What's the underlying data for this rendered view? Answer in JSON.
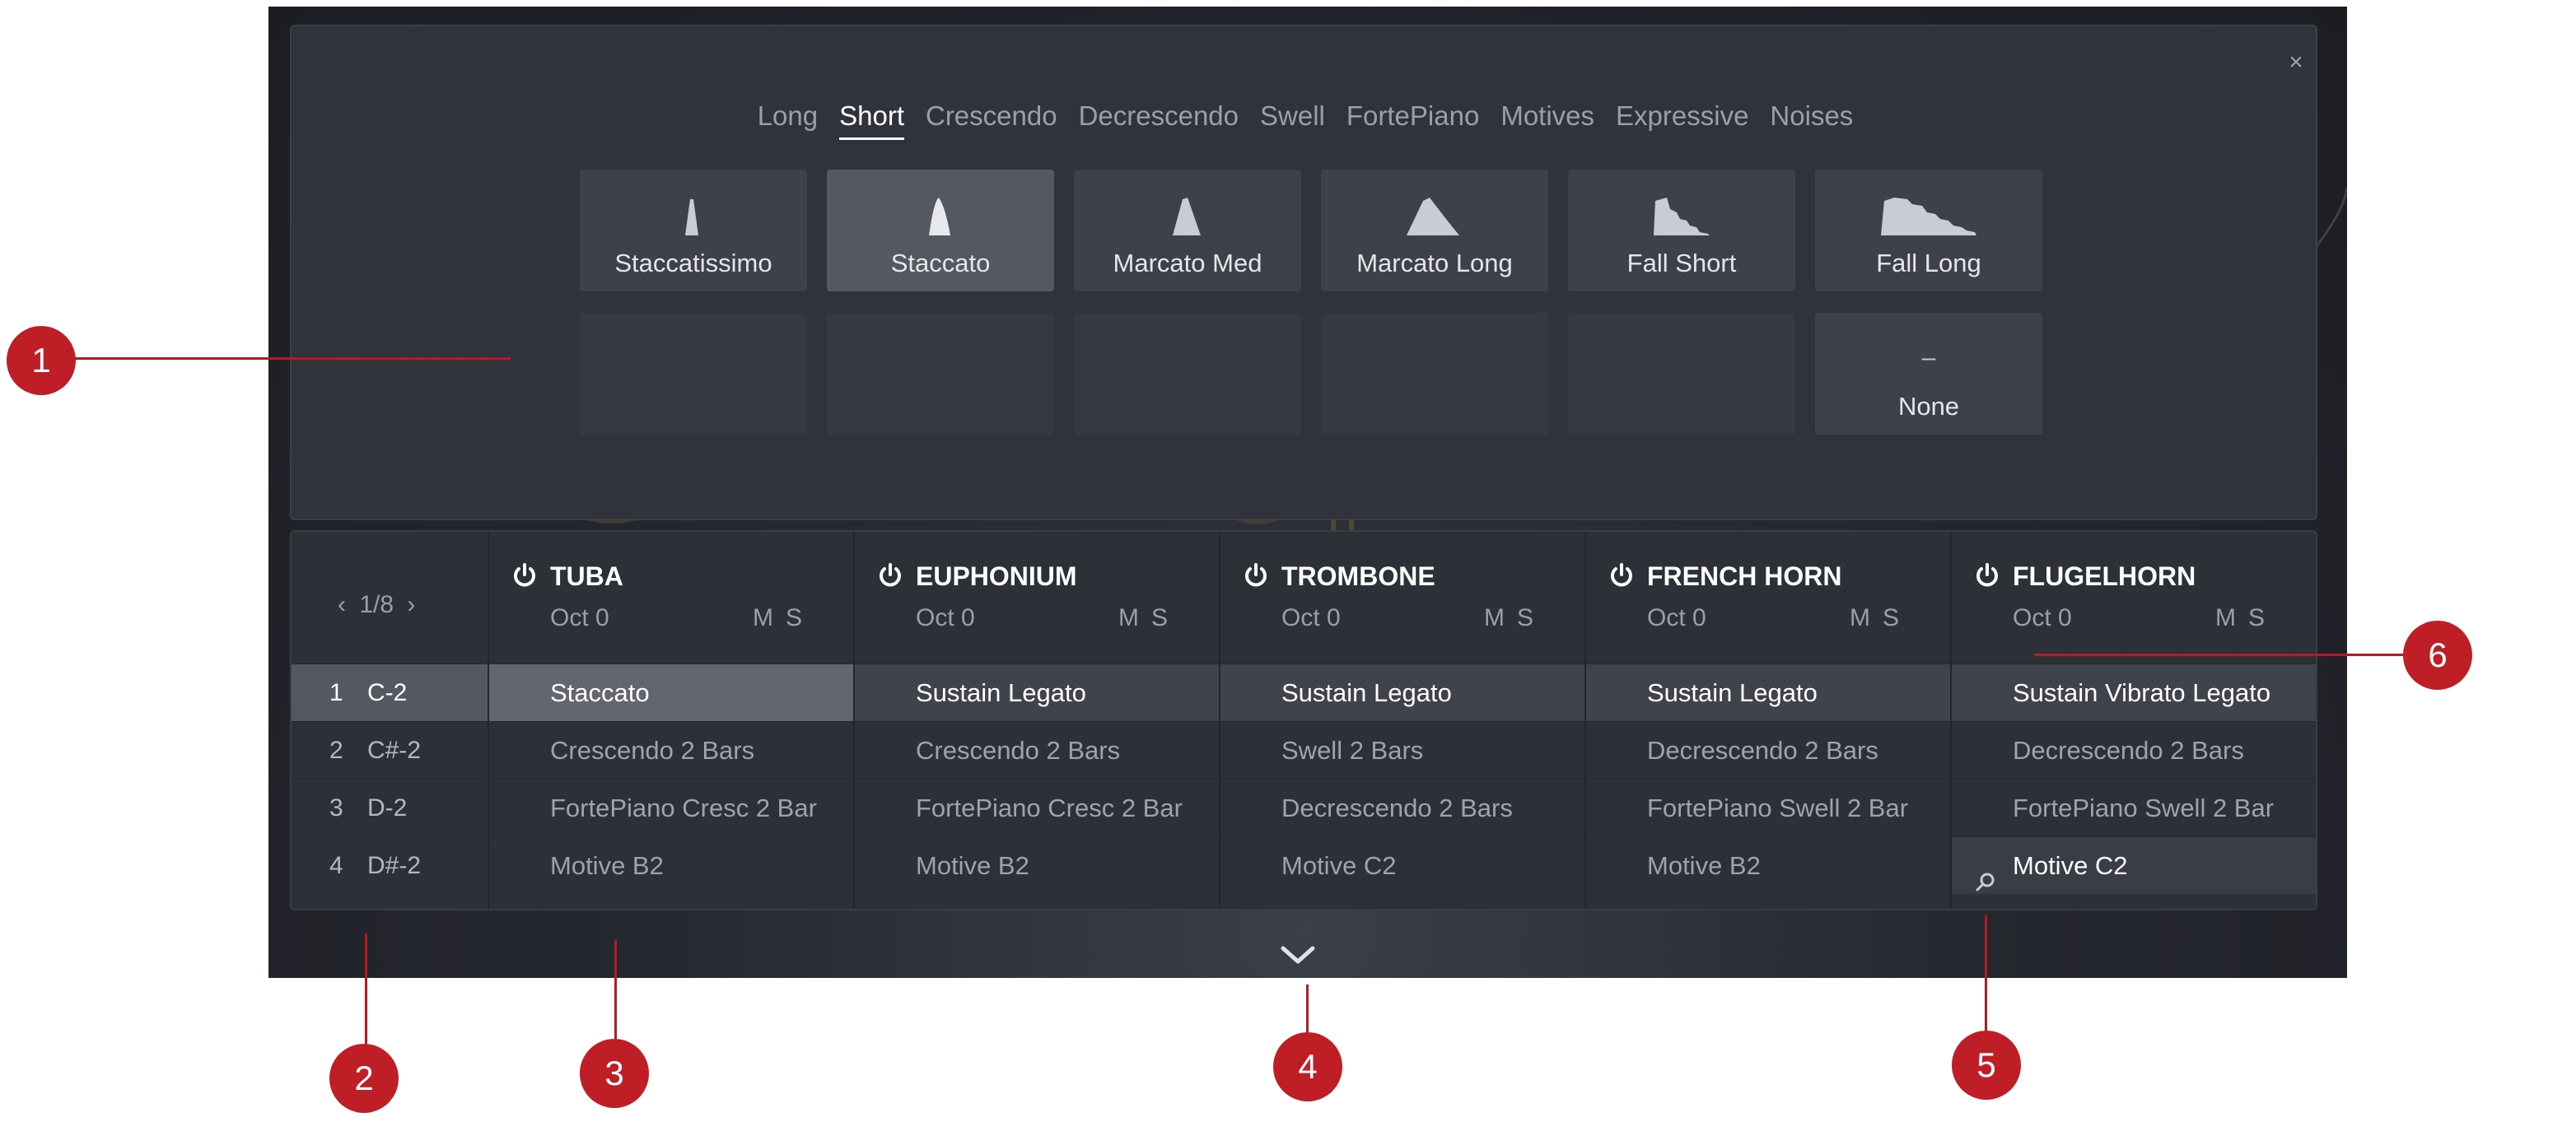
{
  "close_label": "×",
  "tabs": [
    {
      "label": "Long",
      "active": false
    },
    {
      "label": "Short",
      "active": true
    },
    {
      "label": "Crescendo",
      "active": false
    },
    {
      "label": "Decrescendo",
      "active": false
    },
    {
      "label": "Swell",
      "active": false
    },
    {
      "label": "FortePiano",
      "active": false
    },
    {
      "label": "Motives",
      "active": false
    },
    {
      "label": "Expressive",
      "active": false
    },
    {
      "label": "Noises",
      "active": false
    }
  ],
  "articulations": [
    {
      "label": "Staccatissimo",
      "icon": "staccatissimo-icon",
      "selected": false
    },
    {
      "label": "Staccato",
      "icon": "staccato-icon",
      "selected": true
    },
    {
      "label": "Marcato Med",
      "icon": "marcato-med-icon",
      "selected": false
    },
    {
      "label": "Marcato Long",
      "icon": "marcato-long-icon",
      "selected": false
    },
    {
      "label": "Fall Short",
      "icon": "fall-short-icon",
      "selected": false
    },
    {
      "label": "Fall Long",
      "icon": "fall-long-icon",
      "selected": false
    }
  ],
  "none_tile": {
    "dash": "–",
    "label": "None"
  },
  "pager": {
    "prev": "‹",
    "page": "1/8",
    "next": "›"
  },
  "keys": [
    {
      "num": "1",
      "note": "C-2"
    },
    {
      "num": "2",
      "note": "C#-2"
    },
    {
      "num": "3",
      "note": "D-2"
    },
    {
      "num": "4",
      "note": "D#-2"
    }
  ],
  "instruments": [
    {
      "name": "TUBA",
      "octave": "Oct 0",
      "mute": "M",
      "solo": "S",
      "slots": [
        "Staccato",
        "Crescendo 2 Bars",
        "FortePiano Cresc 2 Bar",
        "Motive B2"
      ]
    },
    {
      "name": "EUPHONIUM",
      "octave": "Oct 0",
      "mute": "M",
      "solo": "S",
      "slots": [
        "Sustain Legato",
        "Crescendo 2 Bars",
        "FortePiano Cresc 2 Bar",
        "Motive B2"
      ]
    },
    {
      "name": "TROMBONE",
      "octave": "Oct 0",
      "mute": "M",
      "solo": "S",
      "slots": [
        "Sustain Legato",
        "Swell 2 Bars",
        "Decrescendo 2 Bars",
        "Motive C2"
      ]
    },
    {
      "name": "FRENCH HORN",
      "octave": "Oct 0",
      "mute": "M",
      "solo": "S",
      "slots": [
        "Sustain Legato",
        "Decrescendo 2 Bars",
        "FortePiano Swell 2 Bar",
        "Motive B2"
      ]
    },
    {
      "name": "FLUGELHORN",
      "octave": "Oct 0",
      "mute": "M",
      "solo": "S",
      "slots": [
        "Sustain Vibrato Legato",
        "Decrescendo 2 Bars",
        "FortePiano Swell 2 Bar",
        "Motive C2"
      ]
    }
  ],
  "callouts": [
    "1",
    "2",
    "3",
    "4",
    "5",
    "6"
  ],
  "colors": {
    "accent": "#bf1e27",
    "selected_tile": "#555861",
    "panel": "#30333b"
  }
}
